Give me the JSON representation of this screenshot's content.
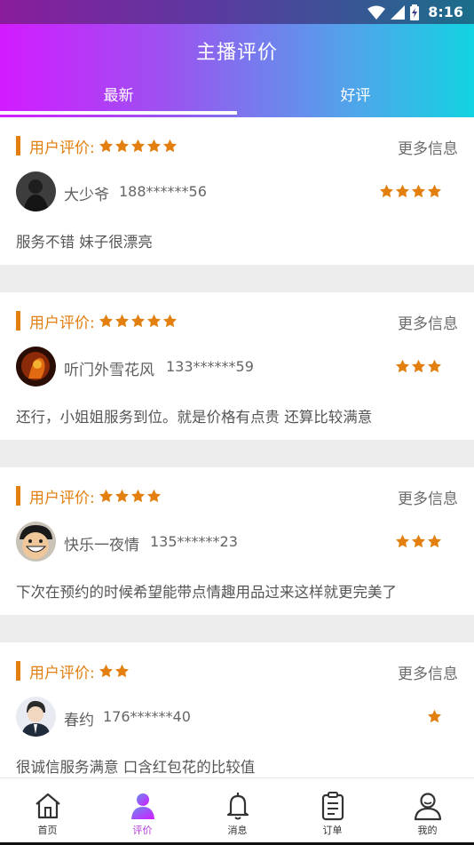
{
  "status_bar": {
    "time": "8:16"
  },
  "header": {
    "title": "主播评价",
    "tabs": [
      {
        "label": "最新",
        "active": true
      },
      {
        "label": "好评",
        "active": false
      }
    ]
  },
  "reviews": [
    {
      "rating_label": "用户评价:",
      "rating": 5,
      "more_label": "更多信息",
      "user_name": "大少爷",
      "phone": "188******56",
      "user_stars": 4,
      "comment": "服务不错 妹子很漂亮"
    },
    {
      "rating_label": "用户评价:",
      "rating": 5,
      "more_label": "更多信息",
      "user_name": "听门外雪花风",
      "phone": "133******59",
      "user_stars": 3,
      "comment": "还行，小姐姐服务到位。就是价格有点贵 还算比较满意"
    },
    {
      "rating_label": "用户评价:",
      "rating": 4,
      "more_label": "更多信息",
      "user_name": "快乐一夜情",
      "phone": "135******23",
      "user_stars": 3,
      "comment": "下次在预约的时候希望能带点情趣用品过来这样就更完美了"
    },
    {
      "rating_label": "用户评价:",
      "rating": 2,
      "more_label": "更多信息",
      "user_name": "春约",
      "phone": "176******40",
      "user_stars": 1,
      "comment": "很诚信服务满意 口含红包花的比较值"
    }
  ],
  "bottom_nav": [
    {
      "label": "首页",
      "icon": "home-icon",
      "active": false
    },
    {
      "label": "评价",
      "icon": "review-person-icon",
      "active": true
    },
    {
      "label": "消息",
      "icon": "bell-icon",
      "active": false
    },
    {
      "label": "订单",
      "icon": "clipboard-icon",
      "active": false
    },
    {
      "label": "我的",
      "icon": "user-icon",
      "active": false
    }
  ],
  "colors": {
    "accent": "#e27f0f",
    "active_nav": "#b03ad9",
    "gradient_start": "#d31bff",
    "gradient_end": "#13d3e1"
  }
}
